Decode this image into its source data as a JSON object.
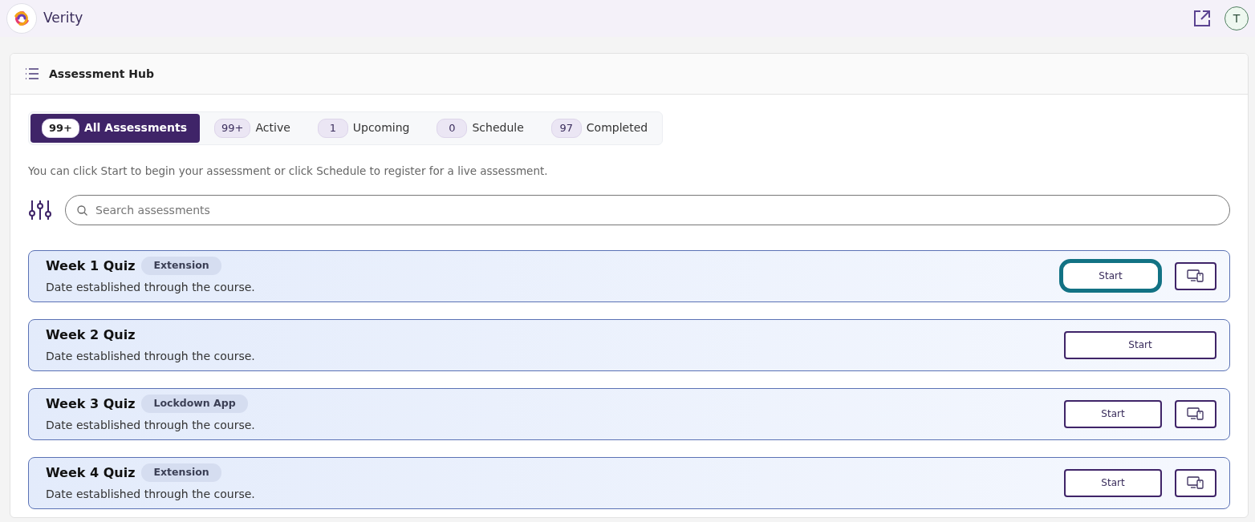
{
  "app": {
    "name": "Verity",
    "avatar": "T"
  },
  "hub": {
    "title": "Assessment Hub"
  },
  "tabs": [
    {
      "count": "99+",
      "label": "All Assessments",
      "selected": true
    },
    {
      "count": "99+",
      "label": "Active",
      "selected": false
    },
    {
      "count": "1",
      "label": "Upcoming",
      "selected": false
    },
    {
      "count": "0",
      "label": "Schedule",
      "selected": false
    },
    {
      "count": "97",
      "label": "Completed",
      "selected": false
    }
  ],
  "hint": "You can click Start to begin your assessment or click Schedule to register for a live assessment.",
  "search": {
    "placeholder": "Search assessments"
  },
  "assessments": [
    {
      "title": "Week 1 Quiz",
      "tag": "Extension",
      "date": "Date established through the course.",
      "action": "Start",
      "focused": true,
      "device_button": true
    },
    {
      "title": "Week 2 Quiz",
      "date": "Date established through the course.",
      "action": "Start",
      "focused": false,
      "device_button": false
    },
    {
      "title": "Week 3 Quiz",
      "tag": "Lockdown App",
      "date": "Date established through the course.",
      "action": "Start",
      "focused": false,
      "device_button": true
    },
    {
      "title": "Week 4 Quiz",
      "tag": "Extension",
      "date": "Date established through the course.",
      "action": "Start",
      "focused": false,
      "device_button": true
    }
  ]
}
